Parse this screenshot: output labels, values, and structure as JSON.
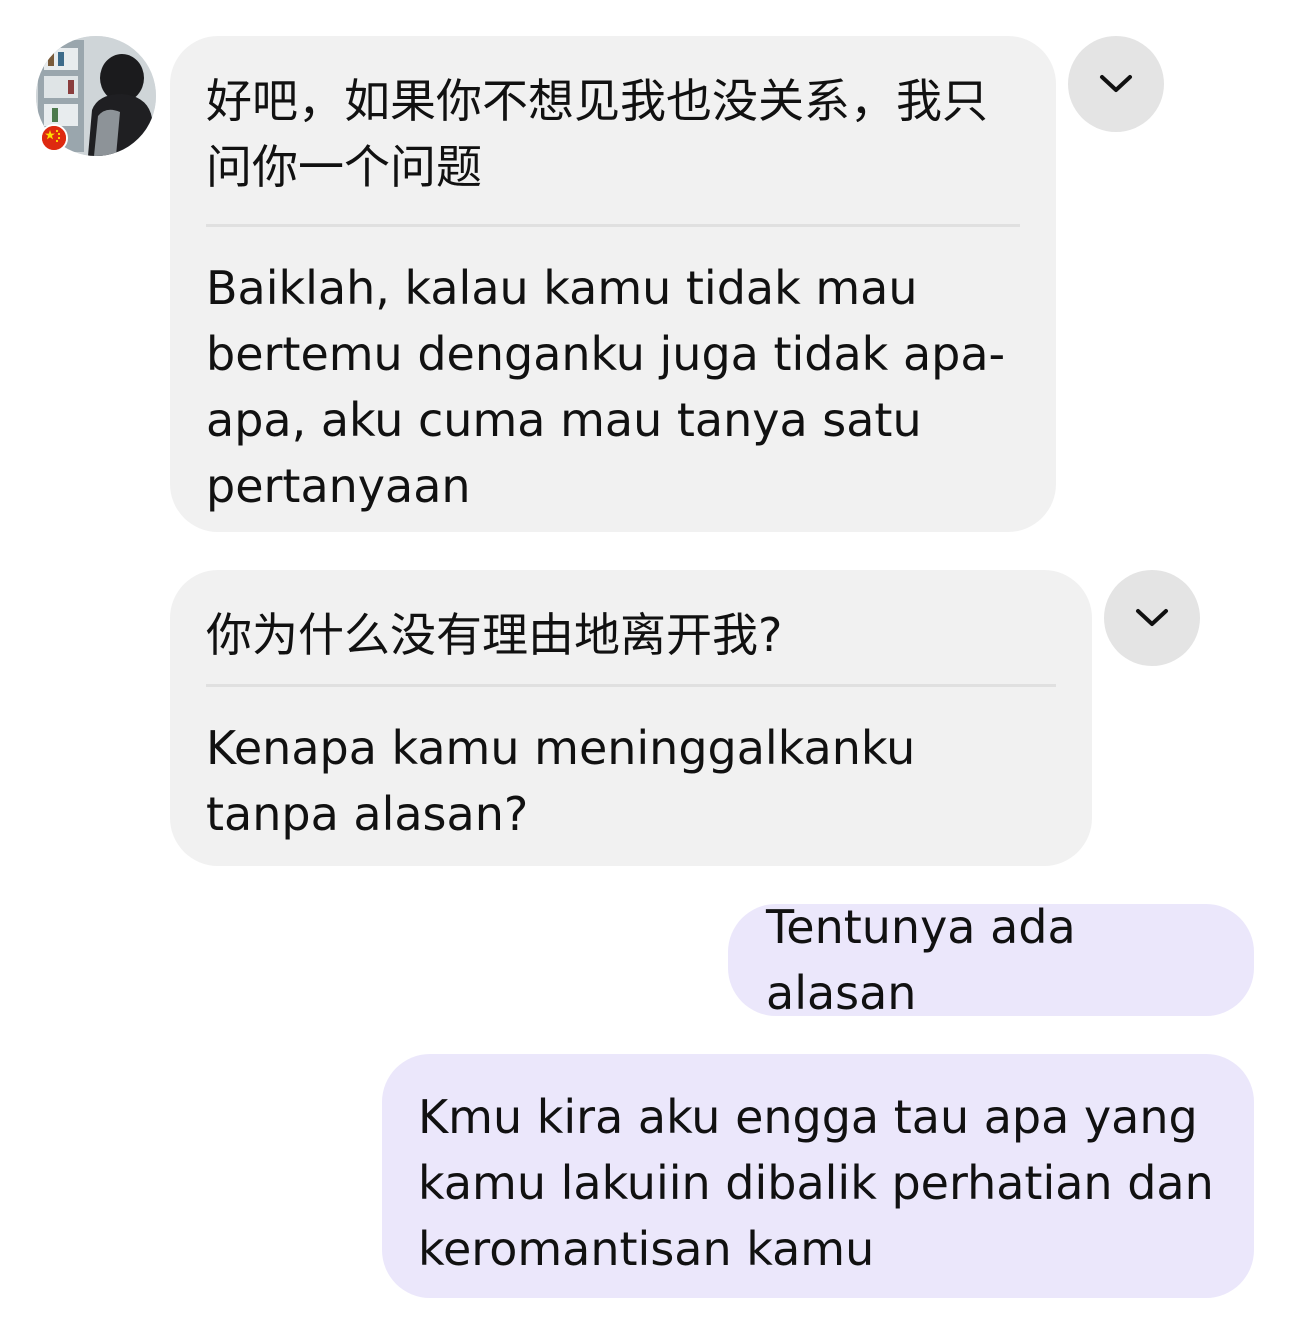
{
  "thread": {
    "messages": [
      {
        "direction": "incoming",
        "original": "好吧，如果你不想见我也没关系，我只问你一个问题",
        "translation": "Baiklah, kalau kamu tidak mau bertemu denganku juga tidak apa-apa, aku cuma mau tanya satu pertanyaan"
      },
      {
        "direction": "incoming",
        "original": "你为什么没有理由地离开我?",
        "translation": "Kenapa kamu meninggalkanku tanpa alasan?"
      },
      {
        "direction": "outgoing",
        "text": "Tentunya ada alasan"
      },
      {
        "direction": "outgoing",
        "text": "Kmu kira aku engga tau apa yang kamu lakuiin dibalik perhatian dan keromantisan kamu"
      }
    ]
  },
  "icons": {
    "avatar": "contact-avatar-photo",
    "flag": "china-flag-icon",
    "message_menu": "chevron-down-icon"
  },
  "colors": {
    "incoming_bubble": "#f1f1f1",
    "outgoing_bubble": "#ebe7fb",
    "menu_button": "#e4e4e4",
    "divider": "#e0e0e0",
    "text": "#111111"
  }
}
